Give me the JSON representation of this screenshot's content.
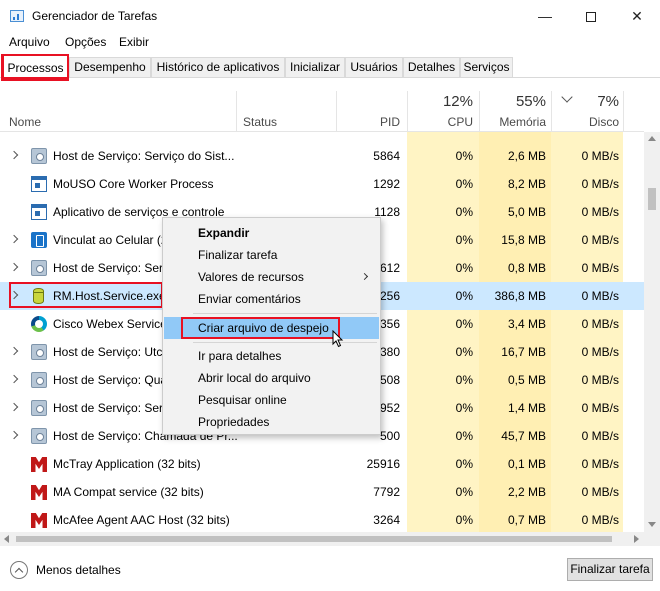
{
  "window": {
    "title": "Gerenciador de Tarefas",
    "controls": {
      "minimize": "—",
      "close": "✕"
    }
  },
  "menu": [
    "Arquivo",
    "Opções",
    "Exibir"
  ],
  "tabs": [
    {
      "label": "Processos",
      "active": true
    },
    {
      "label": "Desempenho"
    },
    {
      "label": "Histórico de aplicativos"
    },
    {
      "label": "Inicializar"
    },
    {
      "label": "Usuários"
    },
    {
      "label": "Detalhes"
    },
    {
      "label": "Serviços"
    }
  ],
  "columns": {
    "name": "Nome",
    "status": "Status",
    "pid": "PID",
    "cpu": {
      "label": "CPU",
      "total": "12%"
    },
    "memory": {
      "label": "Memória",
      "total": "55%"
    },
    "disk": {
      "label": "Disco",
      "total": "7%"
    }
  },
  "processes": [
    {
      "name": "Host de Serviço: Serviço do Sist...",
      "pid": "5864",
      "cpu": "0%",
      "memory": "2,6 MB",
      "disk": "0 MB/s",
      "icon": "gear-icon",
      "expandable": true
    },
    {
      "name": "MoUSO Core Worker Process",
      "pid": "1292",
      "cpu": "0%",
      "memory": "8,2 MB",
      "disk": "0 MB/s",
      "icon": "window-icon",
      "expandable": false
    },
    {
      "name": "Aplicativo de serviços e controle",
      "pid": "1128",
      "cpu": "0%",
      "memory": "5,0 MB",
      "disk": "0 MB/s",
      "icon": "window-icon",
      "expandable": false
    },
    {
      "name": "Vinculat ao Celular (2",
      "pid": "",
      "cpu": "0%",
      "memory": "15,8 MB",
      "disk": "0 MB/s",
      "icon": "phone-icon",
      "expandable": true
    },
    {
      "name": "Host de Serviço: Serv",
      "pid": "612",
      "cpu": "0%",
      "memory": "0,8 MB",
      "disk": "0 MB/s",
      "icon": "gear-icon",
      "expandable": true
    },
    {
      "name": "RM.Host.Service.exe",
      "pid": "256",
      "cpu": "0%",
      "memory": "386,8 MB",
      "disk": "0 MB/s",
      "icon": "database-icon",
      "expandable": true,
      "selected": true
    },
    {
      "name": "Cisco Webex Service",
      "pid": "356",
      "cpu": "0%",
      "memory": "3,4 MB",
      "disk": "0 MB/s",
      "icon": "webex-icon",
      "expandable": false
    },
    {
      "name": "Host de Serviço: UtcS",
      "pid": "380",
      "cpu": "0%",
      "memory": "16,7 MB",
      "disk": "0 MB/s",
      "icon": "gear-icon",
      "expandable": true
    },
    {
      "name": "Host de Serviço: Qua",
      "pid": "508",
      "cpu": "0%",
      "memory": "0,5 MB",
      "disk": "0 MB/s",
      "icon": "gear-icon",
      "expandable": true
    },
    {
      "name": "Host de Serviço: Serv",
      "pid": "952",
      "cpu": "0%",
      "memory": "1,4 MB",
      "disk": "0 MB/s",
      "icon": "gear-icon",
      "expandable": true
    },
    {
      "name": "Host de Serviço: Chamada de Pr...",
      "pid": "500",
      "cpu": "0%",
      "memory": "45,7 MB",
      "disk": "0 MB/s",
      "icon": "gear-icon",
      "expandable": true
    },
    {
      "name": "McTray Application (32 bits)",
      "pid": "25916",
      "cpu": "0%",
      "memory": "0,1 MB",
      "disk": "0 MB/s",
      "icon": "mcafee-icon",
      "expandable": false
    },
    {
      "name": "MA Compat service (32 bits)",
      "pid": "7792",
      "cpu": "0%",
      "memory": "2,2 MB",
      "disk": "0 MB/s",
      "icon": "mcafee-icon",
      "expandable": false
    },
    {
      "name": "McAfee Agent AAC Host (32 bits)",
      "pid": "3264",
      "cpu": "0%",
      "memory": "0,7 MB",
      "disk": "0 MB/s",
      "icon": "mcafee-icon",
      "expandable": false
    }
  ],
  "context_menu": {
    "items": [
      {
        "label": "Expandir",
        "bold": true
      },
      {
        "label": "Finalizar tarefa"
      },
      {
        "label": "Valores de recursos",
        "submenu": true
      },
      {
        "label": "Enviar comentários"
      },
      {
        "label": "Criar arquivo de despejo",
        "hover": true
      },
      {
        "label": "Ir para detalhes"
      },
      {
        "label": "Abrir local do arquivo"
      },
      {
        "label": "Pesquisar online"
      },
      {
        "label": "Propriedades"
      }
    ]
  },
  "footer": {
    "less_details": "Menos detalhes",
    "end_task": "Finalizar tarefa"
  },
  "colors": {
    "highlight_box": "#e81123",
    "heat_fill": "#fff4c4",
    "selection": "#cce8ff",
    "menu_hover": "#91c9f7"
  }
}
